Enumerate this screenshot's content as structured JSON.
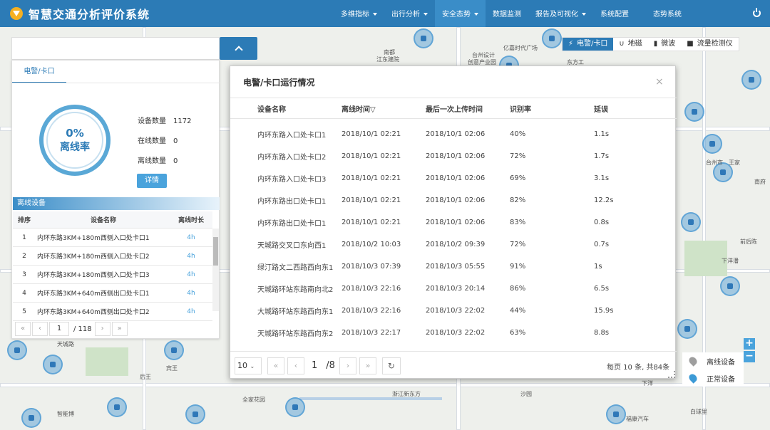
{
  "app_title": "智慧交通分析评价系统",
  "nav": [
    {
      "label": "多维指标",
      "dropdown": true,
      "active": false
    },
    {
      "label": "出行分析",
      "dropdown": true,
      "active": false
    },
    {
      "label": "安全态势",
      "dropdown": true,
      "active": true
    },
    {
      "label": "数据监测",
      "dropdown": false,
      "active": false
    },
    {
      "label": "报告及可视化",
      "dropdown": true,
      "active": false
    },
    {
      "label": "系统配置",
      "dropdown": false,
      "active": false
    },
    {
      "label": "态势系统",
      "dropdown": false,
      "active": false
    }
  ],
  "filters": [
    {
      "label": "电警/卡口",
      "icon": "bolt-icon",
      "active": true
    },
    {
      "label": "地磁",
      "icon": "magnet-icon",
      "active": false
    },
    {
      "label": "微波",
      "icon": "wave-icon",
      "active": false
    },
    {
      "label": "流量检测仪",
      "icon": "camera-icon",
      "active": false
    }
  ],
  "left_panel": {
    "tab": "电警/卡口",
    "gauge_value": "0%",
    "gauge_label": "离线率",
    "stats": [
      {
        "label": "设备数量",
        "value": "1172"
      },
      {
        "label": "在线数量",
        "value": "0"
      },
      {
        "label": "离线数量",
        "value": "0"
      }
    ],
    "detail_button": "详情",
    "offline_title": "离线设备",
    "table_headers": {
      "rank": "排序",
      "name": "设备名称",
      "duration": "离线时长"
    },
    "rows": [
      {
        "rank": "1",
        "name": "内环东路3KM+180m西侧入口处卡口1",
        "duration": "4h"
      },
      {
        "rank": "2",
        "name": "内环东路3KM+180m西侧入口处卡口2",
        "duration": "4h"
      },
      {
        "rank": "3",
        "name": "内环东路3KM+180m西侧入口处卡口3",
        "duration": "4h"
      },
      {
        "rank": "4",
        "name": "内环东路3KM+640m西侧出口处卡口1",
        "duration": "4h"
      },
      {
        "rank": "5",
        "name": "内环东路3KM+640m西侧出口处卡口2",
        "duration": "4h"
      }
    ],
    "pager": {
      "first": "«",
      "prev": "‹",
      "page": "1",
      "total": "/ 118",
      "next": "›",
      "last": "»"
    }
  },
  "modal": {
    "title": "电警/卡口运行情况",
    "close": "×",
    "headers": {
      "name": "设备名称",
      "offline_time": "离线时间▽",
      "last_upload": "最后一次上传时间",
      "rate": "识别率",
      "delay": "延误"
    },
    "rows": [
      {
        "name": "内环东路入口处卡口1",
        "offline_time": "2018/10/1 02:21",
        "last_upload": "2018/10/1 02:06",
        "rate": "40%",
        "delay": "1.1s"
      },
      {
        "name": "内环东路入口处卡口2",
        "offline_time": "2018/10/1 02:21",
        "last_upload": "2018/10/1 02:06",
        "rate": "72%",
        "delay": "1.7s"
      },
      {
        "name": "内环东路入口处卡口3",
        "offline_time": "2018/10/1 02:21",
        "last_upload": "2018/10/1 02:06",
        "rate": "69%",
        "delay": "3.1s"
      },
      {
        "name": "内环东路出口处卡口1",
        "offline_time": "2018/10/1 02:21",
        "last_upload": "2018/10/1 02:06",
        "rate": "82%",
        "delay": "12.2s"
      },
      {
        "name": "内环东路出口处卡口1",
        "offline_time": "2018/10/1 02:21",
        "last_upload": "2018/10/1 02:06",
        "rate": "83%",
        "delay": "0.8s"
      },
      {
        "name": "天城路交叉口东向西1",
        "offline_time": "2018/10/2 10:03",
        "last_upload": "2018/10/2 09:39",
        "rate": "72%",
        "delay": "0.7s"
      },
      {
        "name": "绿汀路文二西路西向东1",
        "offline_time": "2018/10/3 07:39",
        "last_upload": "2018/10/3 05:55",
        "rate": "91%",
        "delay": "1s"
      },
      {
        "name": "天城路环站东路南向北2",
        "offline_time": "2018/10/3 22:16",
        "last_upload": "2018/10/3 20:14",
        "rate": "86%",
        "delay": "6.5s"
      },
      {
        "name": "大城路环站东路西向东1",
        "offline_time": "2018/10/3 22:16",
        "last_upload": "2018/10/3 22:02",
        "rate": "44%",
        "delay": "15.9s"
      },
      {
        "name": "天城路环站东路西向东2",
        "offline_time": "2018/10/3 22:17",
        "last_upload": "2018/10/3 22:02",
        "rate": "63%",
        "delay": "8.8s"
      }
    ],
    "page_size": "10",
    "pager": {
      "first": "«",
      "prev": "‹",
      "page": "1",
      "total": "/8",
      "next": "›",
      "last": "»",
      "refresh": "↻"
    },
    "total_text": "每页 10 条, 共84条"
  },
  "legend": [
    {
      "label": "离线设备",
      "color": "#9e9e9e"
    },
    {
      "label": "正常设备",
      "color": "#3c9ad6"
    }
  ],
  "zoom": {
    "in": "+",
    "out": "−"
  },
  "map_labels": [
    "台州市",
    "王家",
    "南府",
    "下洋潘",
    "前后陈",
    "下洋",
    "沙园",
    "天城路",
    "全家花园",
    "智能博",
    "后王",
    "宾王",
    "浙江新东方",
    "白球里",
    "福康汽车",
    "亿嘉时代广场",
    "东方工",
    "台州设计",
    "创意产业园",
    "南都",
    "江东建院"
  ]
}
